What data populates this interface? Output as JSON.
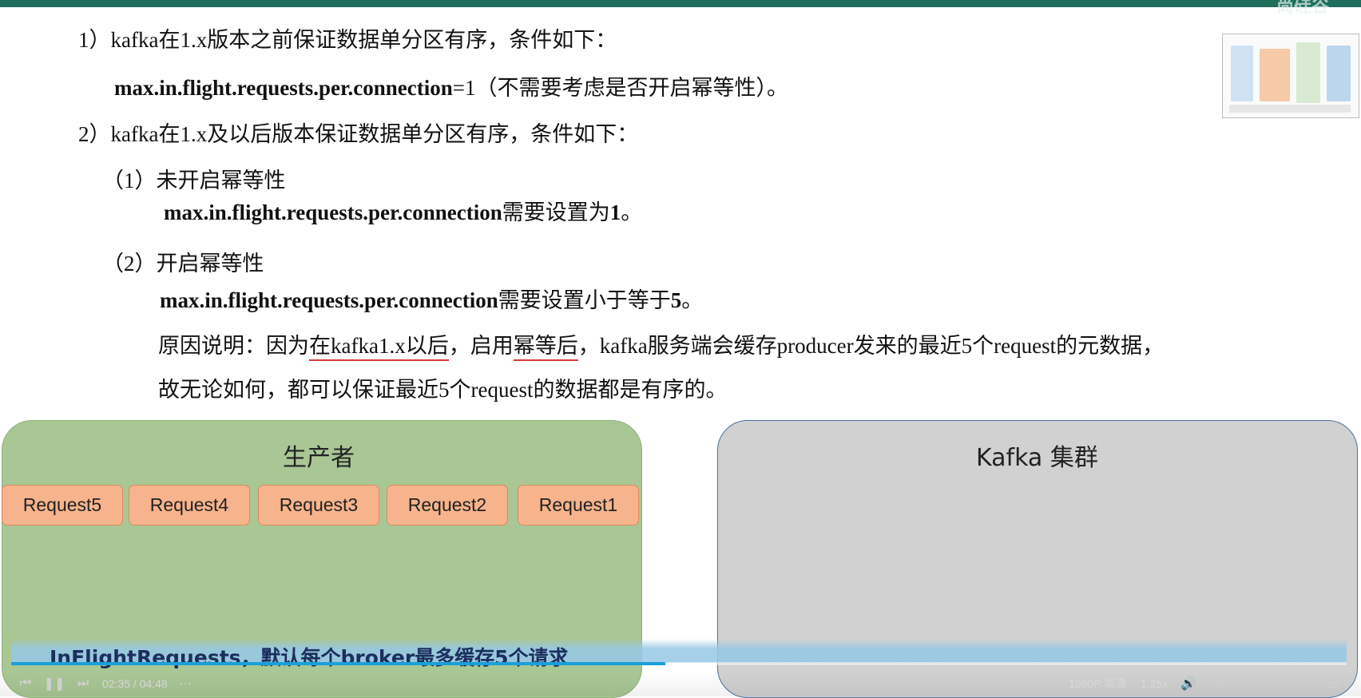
{
  "slide": {
    "watermark": "尚硅谷",
    "rule1": {
      "title": "1）kafka在1.x版本之前保证数据单分区有序，条件如下：",
      "code": "max.in.flight.requests.per.connection",
      "tail": "=1（不需要考虑是否开启幂等性）。"
    },
    "rule2": {
      "title": "2）kafka在1.x及以后版本保证数据单分区有序，条件如下：",
      "case1": {
        "title": "（1）未开启幂等性",
        "code": "max.in.flight.requests.per.connection",
        "tail_text": "需要设置为",
        "tail_value": "1",
        "tail_end": "。"
      },
      "case2": {
        "title": "（2）开启幂等性",
        "code": "max.in.flight.requests.per.connection",
        "tail_text": "需要设置小于等于",
        "tail_value": "5",
        "tail_end": "。"
      }
    },
    "reason": {
      "p1": "原因说明：因为",
      "u1": "在kafka1.x以后",
      "p2": "，",
      "p3": "启用",
      "u2": "幂等后",
      "p4": "，kafka服务端会缓存producer发来的最近5个request的元数据，",
      "line2": "故无论如何，都可以保证最近5个request的数据都是有序的。"
    }
  },
  "diagram": {
    "producer_title": "生产者",
    "cluster_title": "Kafka 集群",
    "requests": [
      "Request5",
      "Request4",
      "Request3",
      "Request2",
      "Request1"
    ]
  },
  "subtitle": "InFlightRequests，默认每个broker最多缓存5个请求",
  "player": {
    "time": "02:35 / 04:48",
    "progress": 0.49,
    "quality": "1080P 高清",
    "speed": "1.25x",
    "colors": {
      "progress": "#1aa0d8",
      "topbar": "#1d6f5c"
    }
  }
}
